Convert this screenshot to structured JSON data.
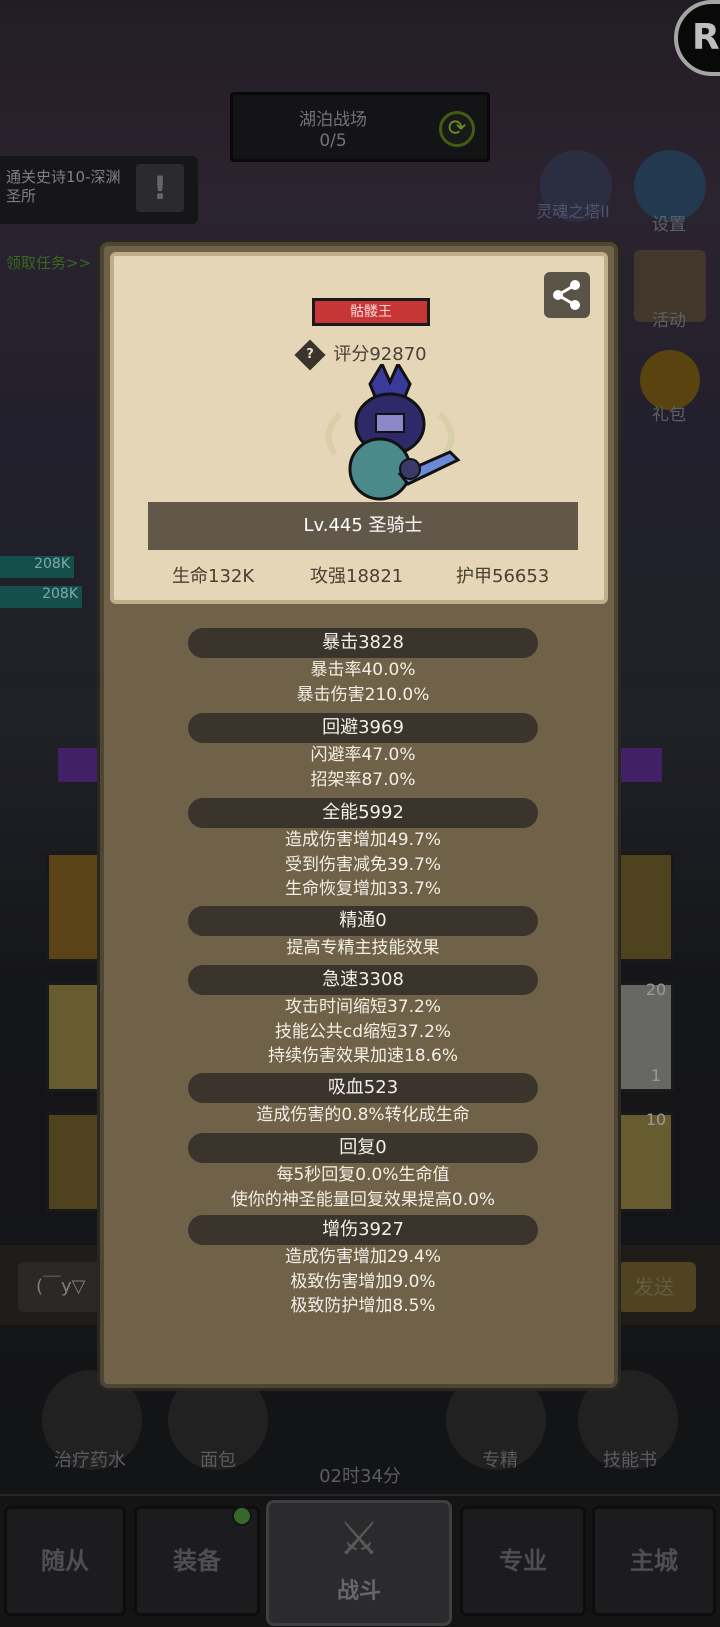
{
  "field": {
    "title": "湖泊战场",
    "progress": "0/5"
  },
  "quest": {
    "text": "通关史诗10-深渊圣所",
    "task": "领取任务>>"
  },
  "right_menu": {
    "tower": "灵魂之塔II",
    "settings": "设置",
    "activity": "活动",
    "gift": "礼包"
  },
  "corner_letter": "R",
  "ally_hp": [
    "208K",
    "208K"
  ],
  "emoticon": "(￣y▽",
  "send_btn": "发送",
  "items": {
    "potion": "治疗药水",
    "bread": "面包",
    "timer": "02时34分",
    "spec": "专精",
    "skillbook": "技能书"
  },
  "slot_counts": [
    "20",
    "1",
    "10"
  ],
  "tabs": {
    "follower": "随从",
    "equipment": "装备",
    "battle": "战斗",
    "profession": "专业",
    "city": "主城"
  },
  "profile": {
    "name": "骷髅王",
    "score": "评分92870",
    "level_class": "Lv.445 圣骑士",
    "hp": "生命132K",
    "attack": "攻强18821",
    "armor": "护甲56653",
    "name_color": "#c63636"
  },
  "stats": [
    {
      "head": "暴击3828",
      "lines": [
        "暴击率40.0%",
        "暴击伤害210.0%"
      ]
    },
    {
      "head": "回避3969",
      "lines": [
        "闪避率47.0%",
        "招架率87.0%"
      ]
    },
    {
      "head": "全能5992",
      "lines": [
        "造成伤害增加49.7%",
        "受到伤害减免39.7%",
        "生命恢复增加33.7%"
      ]
    },
    {
      "head": "精通0",
      "lines": [
        "提高专精主技能效果"
      ]
    },
    {
      "head": "急速3308",
      "lines": [
        "攻击时间缩短37.2%",
        "技能公共cd缩短37.2%",
        "持续伤害效果加速18.6%"
      ]
    },
    {
      "head": "吸血523",
      "lines": [
        "造成伤害的0.8%转化成生命"
      ]
    },
    {
      "head": "回复0",
      "lines": [
        "每5秒回复0.0%生命值",
        "使你的神圣能量回复效果提高0.0%"
      ]
    },
    {
      "head": "增伤3927",
      "lines": [
        "造成伤害增加29.4%",
        "极致伤害增加9.0%",
        "极致防护增加8.5%"
      ]
    }
  ]
}
